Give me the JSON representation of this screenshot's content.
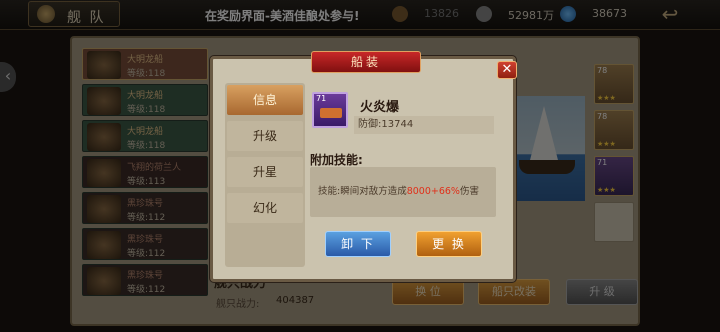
{
  "topbar": {
    "fleet_label": "舰 队",
    "ticker": "在奖励界面-美酒佳酿处参与!",
    "res1": "13826",
    "res2": "52981万",
    "res3": "38673",
    "back_icon": "back-arrow-icon"
  },
  "ships": [
    {
      "name": "大明龙船",
      "level": "等级:118",
      "style": "sel"
    },
    {
      "name": "大明龙船",
      "level": "等级:118",
      "style": ""
    },
    {
      "name": "大明龙船",
      "level": "等级:118",
      "style": ""
    },
    {
      "name": "飞翔的荷兰人",
      "level": "等级:113",
      "style": "dim"
    },
    {
      "name": "黑珍珠号",
      "level": "等级:112",
      "style": "dark"
    },
    {
      "name": "黑珍珠号",
      "level": "等级:112",
      "style": "dark"
    },
    {
      "name": "黑珍珠号",
      "level": "等级:112",
      "style": "dark"
    }
  ],
  "slots": [
    {
      "lv": "78",
      "style": ""
    },
    {
      "lv": "78",
      "style": ""
    },
    {
      "lv": "71",
      "style": "purple"
    },
    {
      "lv": "",
      "style": "empty"
    }
  ],
  "bottom": {
    "combat_label": "舰只战力",
    "power_label": "舰只战力:",
    "power_value": "404387",
    "btn_swap": "换 位",
    "btn_refit": "船只改装",
    "btn_upgrade": "升 级"
  },
  "dialog": {
    "title": "船装",
    "close": "✕",
    "tabs": [
      "信息",
      "升级",
      "升星",
      "幻化"
    ],
    "equip_level": "71",
    "equip_name": "火炎爆",
    "equip_stat": "防御:13744",
    "skill_label": "附加技能:",
    "skill_prefix": "技能:瞬间对敌方造成",
    "skill_value": "8000+66%",
    "skill_suffix": "伤害",
    "btn_unload": "卸 下",
    "btn_replace": "更 换"
  },
  "colors": {
    "accent_red": "#c82828",
    "highlight_red": "#e0301a",
    "btn_blue": "#2a5aa8",
    "btn_orange": "#b06010"
  }
}
